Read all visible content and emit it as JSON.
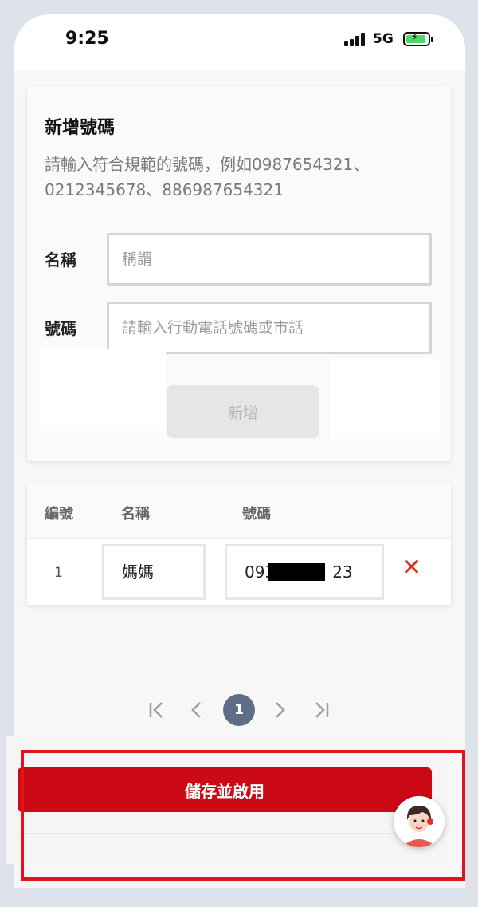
{
  "status_bar": {
    "time": "9:25",
    "network": "5G",
    "battery_icon": "battery-charging-icon",
    "signal_icon": "signal-bars-icon"
  },
  "add_form": {
    "title": "新增號碼",
    "hint": "請輸入符合規範的號碼，例如0987654321、0212345678、886987654321",
    "name_label": "名稱",
    "name_placeholder": "稱謂",
    "number_label": "號碼",
    "number_placeholder": "請輸入行動電話號碼或市話",
    "add_button": "新增"
  },
  "table": {
    "headers": [
      "編號",
      "名稱",
      "號碼"
    ],
    "rows": [
      {
        "no": "1",
        "name": "媽媽",
        "number_prefix": "093",
        "number_suffix": "23"
      }
    ],
    "delete_icon": "close-icon"
  },
  "pager": {
    "first": "|<",
    "prev": "<",
    "current": "1",
    "next": ">",
    "last": ">|"
  },
  "save_button": "儲存並啟用",
  "colors": {
    "primary_red": "#cc0a15",
    "highlight_border": "#e0141c",
    "delete_red": "#e2312b",
    "pager_active": "#5e6e86"
  }
}
